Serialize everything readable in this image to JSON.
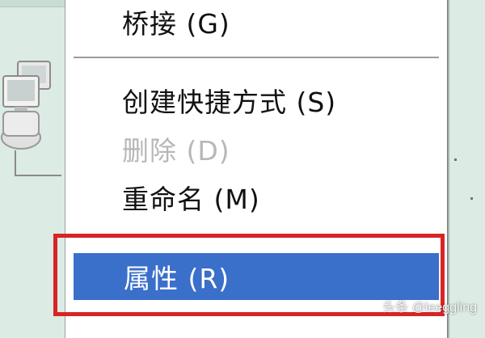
{
  "menu": {
    "items": [
      {
        "label": "桥接 (G)",
        "enabled": true
      },
      {
        "label": "创建快捷方式 (S)",
        "enabled": true
      },
      {
        "label": "删除 (D)",
        "enabled": false
      },
      {
        "label": "重命名 (M)",
        "enabled": true
      },
      {
        "label": "属性 (R)",
        "enabled": true,
        "highlighted": true
      }
    ]
  },
  "watermark": "头条 @leeggling",
  "colors": {
    "highlight": "#3a6fca",
    "annotation_border": "#d82524",
    "background": "#dcebe4"
  },
  "icons": [
    "network-connection-icon"
  ]
}
